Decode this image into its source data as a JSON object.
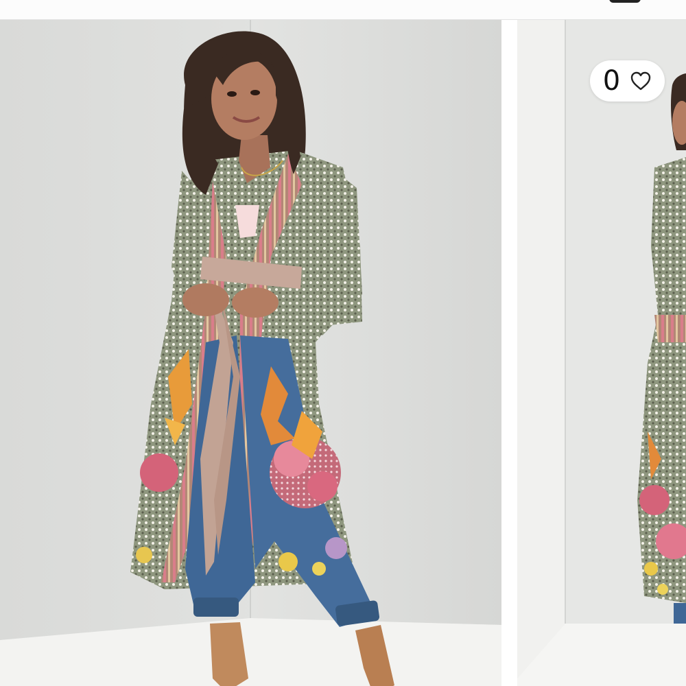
{
  "wishlist": {
    "count": "0",
    "icon": "heart-outline-icon"
  },
  "carousel": {
    "images": [
      {
        "name": "product-image-front"
      },
      {
        "name": "product-image-back"
      }
    ]
  },
  "colors": {
    "studio_wall": "#e4e5e3",
    "studio_floor": "#f2f2f0",
    "kimono_base": "#9aa08c",
    "denim": "#3f6796",
    "boots": "#c08a5d",
    "flower_pink": "#e0738a"
  }
}
